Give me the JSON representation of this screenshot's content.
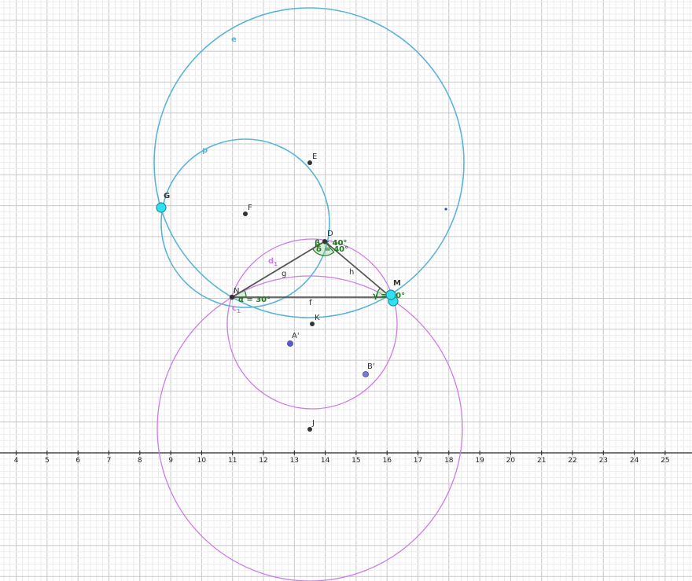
{
  "axis": {
    "x_ticks": [
      "4",
      "5",
      "6",
      "7",
      "8",
      "9",
      "10",
      "11",
      "12",
      "13",
      "14",
      "15",
      "16",
      "17",
      "18",
      "19",
      "20",
      "21",
      "22",
      "23",
      "24",
      "25"
    ]
  },
  "colors": {
    "blue_circle": "#5ab4d6",
    "pink_circle": "#cc7ee6",
    "segment": "#555555",
    "point_dark": "#333333",
    "point_cyan": "#2fe0f0",
    "point_violet": "#5a5ad0",
    "angle": "#1e7a1e"
  },
  "circles": [
    {
      "name": "e",
      "color": "blue_circle",
      "label": "e"
    },
    {
      "name": "p",
      "color": "blue_circle",
      "label": "p"
    },
    {
      "name": "d1",
      "color": "pink_circle",
      "label": "d",
      "sub": "1"
    },
    {
      "name": "c1",
      "color": "pink_circle",
      "label": "c",
      "sub": "1"
    }
  ],
  "points": [
    {
      "name": "E",
      "label": "E"
    },
    {
      "name": "F",
      "label": "F"
    },
    {
      "name": "G",
      "label": "G"
    },
    {
      "name": "D",
      "label": "D"
    },
    {
      "name": "N",
      "label": "N"
    },
    {
      "name": "M",
      "label": "M"
    },
    {
      "name": "K",
      "label": "K"
    },
    {
      "name": "A'",
      "label": "A'"
    },
    {
      "name": "B'",
      "label": "B'"
    },
    {
      "name": "J",
      "label": "J"
    }
  ],
  "segments": [
    {
      "name": "f",
      "label": "f"
    },
    {
      "name": "g",
      "label": "g"
    },
    {
      "name": "h",
      "label": "h"
    }
  ],
  "angles": [
    {
      "name": "alpha",
      "label": "α = 30°"
    },
    {
      "name": "beta",
      "label": "β = 40°"
    },
    {
      "name": "delta",
      "label": "δ = 40°"
    },
    {
      "name": "gamma",
      "label": "γ = 30°"
    }
  ]
}
